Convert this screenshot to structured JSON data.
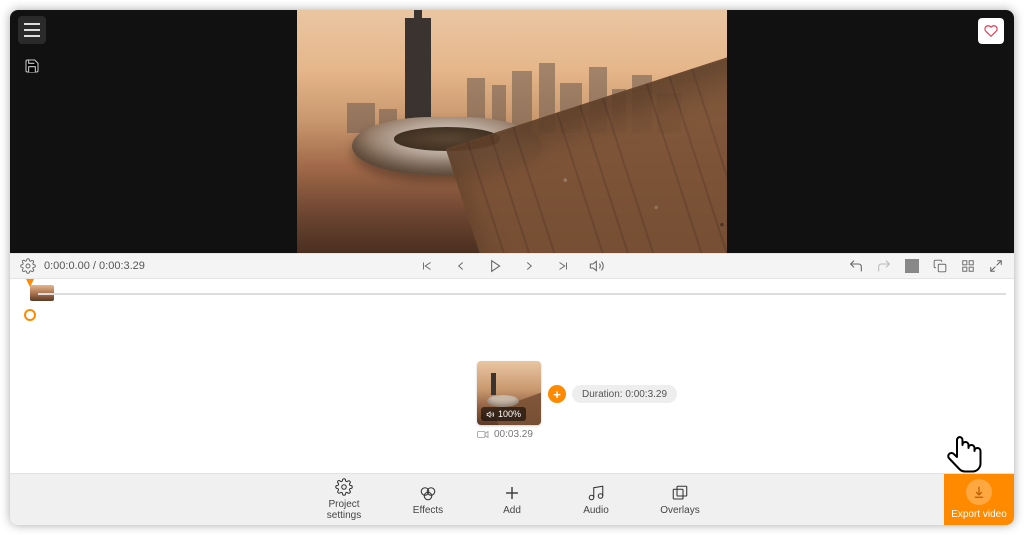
{
  "playback": {
    "current_time": "0:00:0.00",
    "total_time": "0:00:3.29"
  },
  "clip": {
    "volume_label": "100%",
    "length": "00:03.29",
    "duration_chip": "Duration: 0:00:3.29"
  },
  "toolbar": {
    "project_settings": "Project\nsettings",
    "effects": "Effects",
    "add": "Add",
    "audio": "Audio",
    "overlays": "Overlays"
  },
  "export": {
    "label": "Export video"
  }
}
